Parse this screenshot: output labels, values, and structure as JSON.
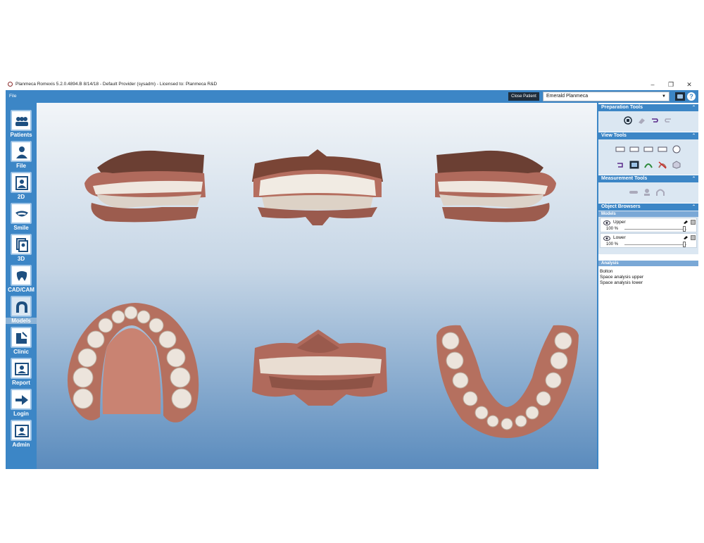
{
  "window": {
    "title": "Planmeca Romexis 5.2.0.4894.B  8/14/18 - Default Provider (sysadm) - Licensed to: Planmeca R&D",
    "controls": {
      "minimize": "–",
      "maximize": "❐",
      "close": "✕"
    }
  },
  "menubar": {
    "file": "File",
    "close_patient": "Close Patient",
    "patient": "Emerald Planmeca",
    "help": "?"
  },
  "sidebar": {
    "items": [
      {
        "label": "Patients",
        "icon": "patients-icon"
      },
      {
        "label": "File",
        "icon": "file-icon"
      },
      {
        "label": "2D",
        "icon": "2d-icon"
      },
      {
        "label": "Smile",
        "icon": "smile-icon"
      },
      {
        "label": "3D",
        "icon": "3d-icon"
      },
      {
        "label": "CAD/CAM",
        "icon": "cadcam-icon"
      },
      {
        "label": "Models",
        "icon": "models-icon",
        "active": true
      },
      {
        "label": "Clinic",
        "icon": "clinic-icon"
      },
      {
        "label": "Report",
        "icon": "report-icon"
      },
      {
        "label": "Login",
        "icon": "login-icon"
      },
      {
        "label": "Admin",
        "icon": "admin-icon"
      }
    ]
  },
  "viewport": {
    "views": [
      "right-occlusion-view",
      "front-occlusion-view",
      "left-occlusion-view",
      "upper-occlusal-view",
      "posterior-view",
      "lower-occlusal-view"
    ]
  },
  "panel": {
    "preparation_tools": {
      "title": "Preparation Tools",
      "collapse": "⌃"
    },
    "view_tools": {
      "title": "View Tools",
      "collapse": "⌃"
    },
    "measurement_tools": {
      "title": "Measurement Tools",
      "collapse": "⌃"
    },
    "object_browsers": {
      "title": "Object Browsers",
      "collapse": "⌃",
      "models_header": "Models",
      "models": [
        {
          "name": "Upper",
          "opacity": "100 %"
        },
        {
          "name": "Lower",
          "opacity": "100 %"
        }
      ],
      "analysis_header": "Analysis",
      "analysis": [
        "Bolton",
        "Space analysis upper",
        "Space analysis lower"
      ]
    }
  },
  "colors": {
    "accent": "#3c86c6",
    "panel_bg": "#dbe7f2",
    "dark_button": "#1e2c3a"
  }
}
